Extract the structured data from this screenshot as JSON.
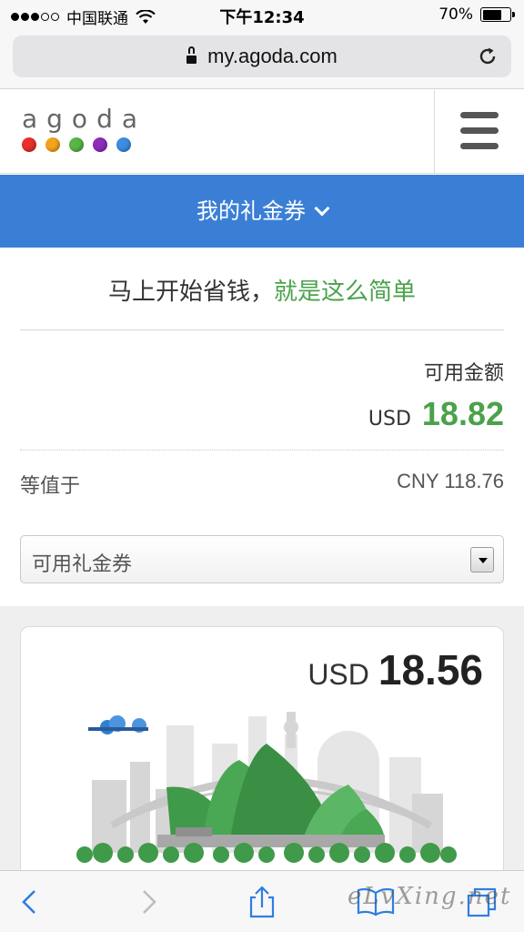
{
  "status_bar": {
    "carrier": "中国联通",
    "time": "下午12:34",
    "battery_percent": "70%",
    "battery_level": 0.7
  },
  "browser": {
    "url": "my.agoda.com"
  },
  "site": {
    "logo_text": "agoda",
    "logo_dot_colors": [
      "#e8302b",
      "#f5a21c",
      "#57b647",
      "#8c2dbb",
      "#3b8de0"
    ]
  },
  "nav": {
    "title": "我的礼金券"
  },
  "main": {
    "tagline_part1": "马上开始省钱，",
    "tagline_part2": "就是这么简单",
    "available_label": "可用金额",
    "available_currency": "USD",
    "available_value": "18.82",
    "equivalent_label": "等值于",
    "equivalent_value": "CNY 118.76",
    "select_value": "可用礼金券"
  },
  "coupon": {
    "currency": "USD",
    "value": "18.56"
  },
  "watermark": "eLvXing.net",
  "colors": {
    "accent_blue": "#3a7fd5",
    "green": "#4aa24b"
  }
}
